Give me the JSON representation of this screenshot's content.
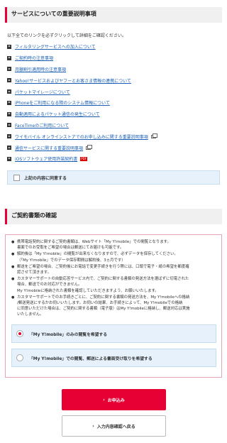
{
  "section1": {
    "title": "サービスについての重要説明事項",
    "intro": "以下全てのリンクを必ずクリックして詳細をご確認ください。",
    "links": [
      "フィルタリングサービスへの加入について",
      "ご契約時の注意事項",
      "月額割引適用時の注意事項",
      "Yahoo!サービスおよびヤフーとお客さま情報の連携について",
      "パケットマイレージについて",
      "iPhoneをご利用になる際のシステム情報について",
      "自動適用によるパケット通信の発生について",
      "FaceTimeのご利用について",
      "ワイモバイル オンラインストアでのお申し込みに関する重要説明事項",
      "通信サービスに関する重要説明事項",
      "iOSソフトウェア使用許諾契約書"
    ],
    "agree_label": "上記の内容に同意する"
  },
  "section2": {
    "title": "ご契約書類の確認",
    "notes": [
      [
        "携帯電話契約に関するご契約書類は、Webサイト「My Y!mobile」での閲覧となります。",
        "書面でのお受取をご希望の場合は郵送にてお届けも可能です。"
      ],
      [
        "解約後は「My Y!mobile」の閲覧が出来なくなりますので、必ずデータを保存してください。",
        "（「My Y!mobile」でのデータ保存期間は解約後、3ヵ月です）"
      ],
      [
        "郵送をご希望の場合、ご契約後にお電話で変更手続きを行う際には、口頭で電子・紙の希望を都度確",
        "認させて頂きます。"
      ],
      [
        "カスタマーサポートの自動応答サービス内で、ご契約に関する書類の発送方法を選ばずに切電された",
        "場合、郵送でのお対応ができません。",
        "My Y!mobileに格納された書類を確認していただきますよう、お願いいたします。"
      ],
      [
        "カスタマーサポートでのお手続きごとに、ご契約に関する書類の発送方法を、My Y!mobileへの格納",
        "/郵送発送にするかお伺いいたします。お伺いの結果、お手続きによって、My Y!mobileでの格納",
        "に同意いただけた場合は、ご契約に関する書類（電子版）はMy Y!mobileに格納し、郵送対応は実施",
        "いたしません。"
      ]
    ],
    "options": [
      "「My Y!mobile」のみの閲覧を希望する",
      "「My Y!mobile」での閲覧、郵送による書面受け取りを希望する"
    ]
  },
  "buttons": {
    "apply": "お申込み",
    "back": "入力内容確認へ戻る"
  },
  "colors": {
    "accent": "#e60033",
    "link": "#1a5fb4",
    "box": "#e6f1fb"
  }
}
